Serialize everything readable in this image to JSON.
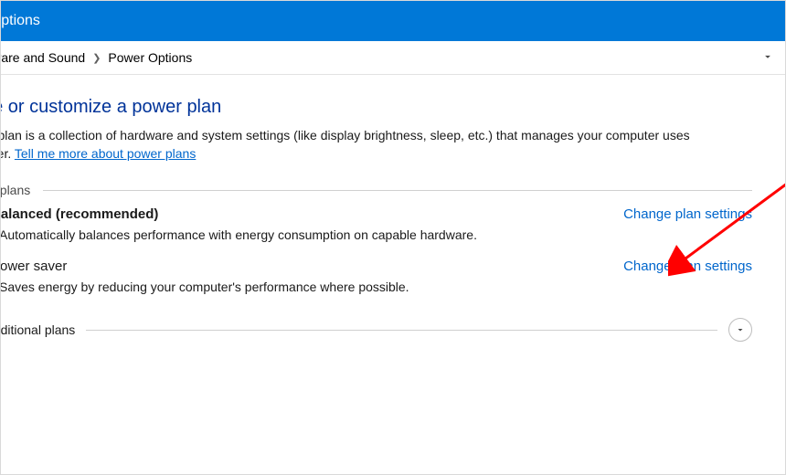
{
  "titlebar": {
    "title": "r Options"
  },
  "breadcrumb": {
    "item1": "ardware and Sound",
    "item2": "Power Options"
  },
  "main": {
    "heading": "ose or customize a power plan",
    "description_prefix": "wer plan is a collection of hardware and system settings (like display brightness, sleep, etc.) that manages your computer uses power. ",
    "learn_more": "Tell me more about power plans"
  },
  "preferred_plans_label": "rred plans",
  "plans": [
    {
      "radio": ")",
      "name": "Balanced (recommended)",
      "selected": true,
      "change_link": "Change plan settings",
      "description": "Automatically balances performance with energy consumption on capable hardware."
    },
    {
      "radio": ")",
      "name": "Power saver",
      "selected": false,
      "change_link": "Change plan settings",
      "description": "Saves energy by reducing your computer's performance where possible."
    }
  ],
  "additional_plans_label": "w additional plans"
}
